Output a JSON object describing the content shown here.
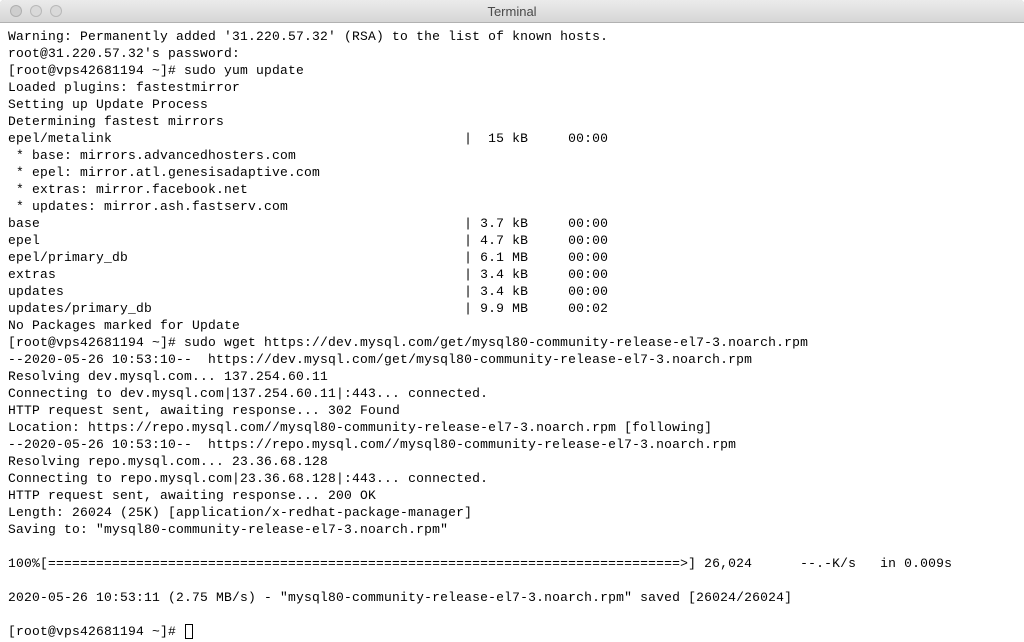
{
  "titlebar": {
    "title": "Terminal"
  },
  "lines": {
    "l0": "Warning: Permanently added '31.220.57.32' (RSA) to the list of known hosts.",
    "l1": "root@31.220.57.32's password:",
    "l2": "[root@vps42681194 ~]# sudo yum update",
    "l3": "Loaded plugins: fastestmirror",
    "l4": "Setting up Update Process",
    "l5": "Determining fastest mirrors",
    "l6": "epel/metalink                                            |  15 kB     00:00",
    "l7": " * base: mirrors.advancedhosters.com",
    "l8": " * epel: mirror.atl.genesisadaptive.com",
    "l9": " * extras: mirror.facebook.net",
    "l10": " * updates: mirror.ash.fastserv.com",
    "l11": "base                                                     | 3.7 kB     00:00",
    "l12": "epel                                                     | 4.7 kB     00:00",
    "l13": "epel/primary_db                                          | 6.1 MB     00:00",
    "l14": "extras                                                   | 3.4 kB     00:00",
    "l15": "updates                                                  | 3.4 kB     00:00",
    "l16": "updates/primary_db                                       | 9.9 MB     00:02",
    "l17": "No Packages marked for Update",
    "l18": "[root@vps42681194 ~]# sudo wget https://dev.mysql.com/get/mysql80-community-release-el7-3.noarch.rpm",
    "l19": "--2020-05-26 10:53:10--  https://dev.mysql.com/get/mysql80-community-release-el7-3.noarch.rpm",
    "l20": "Resolving dev.mysql.com... 137.254.60.11",
    "l21": "Connecting to dev.mysql.com|137.254.60.11|:443... connected.",
    "l22": "HTTP request sent, awaiting response... 302 Found",
    "l23": "Location: https://repo.mysql.com//mysql80-community-release-el7-3.noarch.rpm [following]",
    "l24": "--2020-05-26 10:53:10--  https://repo.mysql.com//mysql80-community-release-el7-3.noarch.rpm",
    "l25": "Resolving repo.mysql.com... 23.36.68.128",
    "l26": "Connecting to repo.mysql.com|23.36.68.128|:443... connected.",
    "l27": "HTTP request sent, awaiting response... 200 OK",
    "l28": "Length: 26024 (25K) [application/x-redhat-package-manager]",
    "l29": "Saving to: \"mysql80-community-release-el7-3.noarch.rpm\"",
    "l30": "",
    "l31": "100%[===============================================================================>] 26,024      --.-K/s   in 0.009s",
    "l32": "",
    "l33": "2020-05-26 10:53:11 (2.75 MB/s) - \"mysql80-community-release-el7-3.noarch.rpm\" saved [26024/26024]",
    "l34": "",
    "l35": "[root@vps42681194 ~]# "
  }
}
